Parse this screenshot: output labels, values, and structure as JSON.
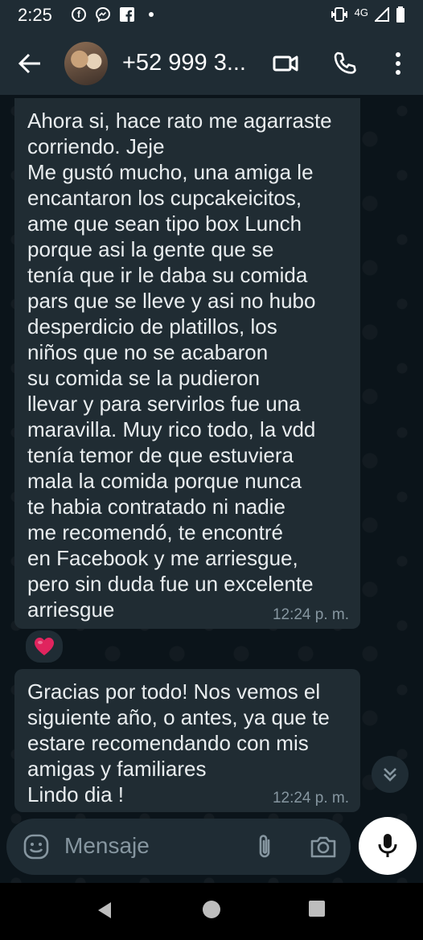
{
  "status_bar": {
    "time": "2:25",
    "network": "4G",
    "icons": [
      "facebook-icon",
      "messenger-icon",
      "facebook-square-icon",
      "notification-dot-icon",
      "vibrate-icon",
      "signal-icon",
      "battery-icon"
    ]
  },
  "header": {
    "contact_name": "+52 999 3...",
    "icons": [
      "back-arrow-icon",
      "video-call-icon",
      "phone-icon",
      "more-icon"
    ]
  },
  "messages": [
    {
      "text": "Ahora si, hace rato me agarraste\ncorriendo. Jeje\nMe gustó mucho, una amiga le\nencantaron los cupcakeicitos,\name que sean tipo box Lunch\nporque asi la gente que se\ntenía que ir le daba su comida\npars que se lleve y asi no hubo\ndesperdicio de platillos, los\nniños que no se acabaron\nsu comida se la pudieron\nllevar y para servirlos fue una\nmaravilla. Muy rico todo, la vdd\ntenía temor de que estuviera\nmala la comida porque nunca\nte habia contratado ni nadie\nme recomendó, te encontré\nen Facebook y me arriesgue,\npero sin duda fue un excelente\narriesgue",
      "time": "12:24 p. m.",
      "reaction": "❤️"
    },
    {
      "text": "Gracias por todo! Nos vemos el\nsiguiente año, o antes, ya que te\nestare recomendando con mis\namigas y familiares\nLindo dia !",
      "time": "12:24 p. m."
    }
  ],
  "composer": {
    "placeholder": "Mensaje"
  },
  "colors": {
    "bubble": "#202c33",
    "background": "#0b141a",
    "header": "#1f2c34",
    "time_text": "#8696a0"
  }
}
